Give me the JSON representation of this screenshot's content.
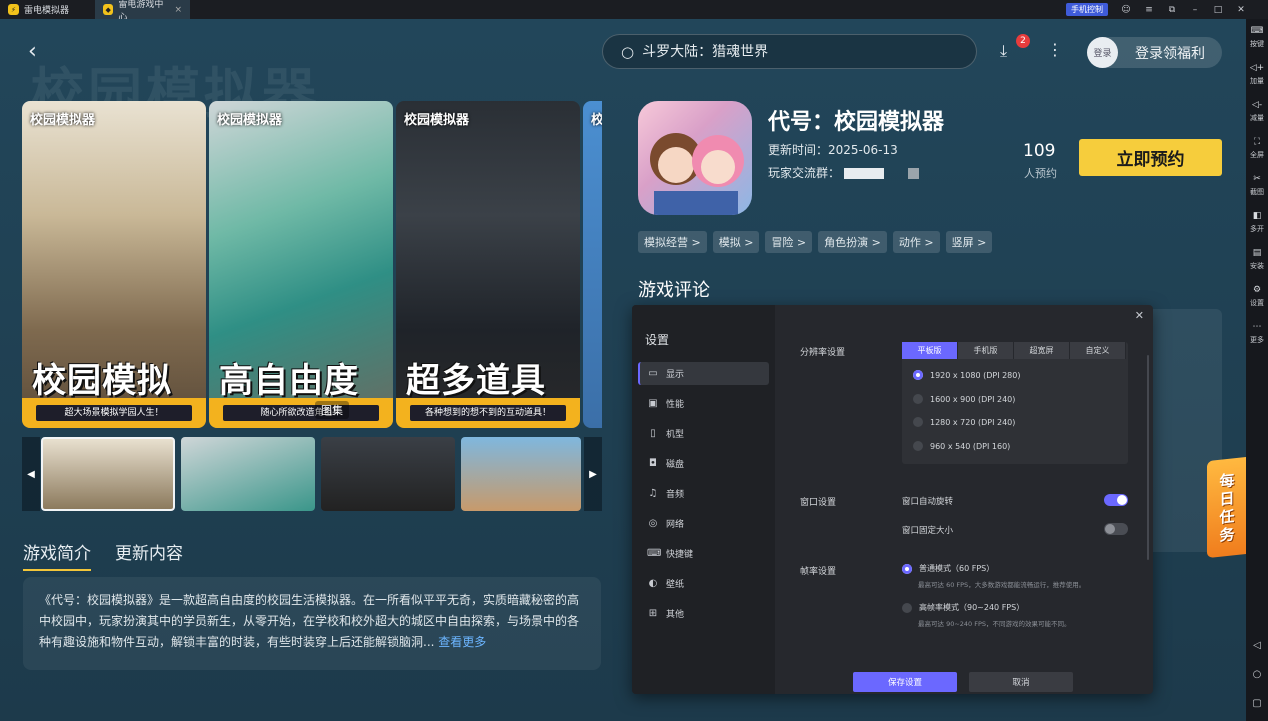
{
  "window_tabs": [
    {
      "label": "雷电模拟器"
    },
    {
      "label": "雷电游戏中心"
    }
  ],
  "titlebar": {
    "phone_control": "手机控制"
  },
  "sidebar": {
    "items": [
      {
        "label": "按键",
        "icon": "keyboard-icon"
      },
      {
        "label": "加量",
        "icon": "volume-up-icon"
      },
      {
        "label": "减量",
        "icon": "volume-down-icon"
      },
      {
        "label": "全屏",
        "icon": "fullscreen-icon"
      },
      {
        "label": "截图",
        "icon": "scissors-icon"
      },
      {
        "label": "多开",
        "icon": "multi-instance-icon"
      },
      {
        "label": "安装",
        "icon": "apk-install-icon"
      },
      {
        "label": "设置",
        "icon": "gear-icon"
      },
      {
        "label": "更多",
        "icon": "more-icon"
      }
    ]
  },
  "header": {
    "search_placeholder": "斗罗大陆：猎魂世界",
    "download_badge": "2",
    "login_avatar": "登录",
    "login_text": "登录领福利"
  },
  "screenshots": [
    {
      "brand": "校园模拟器",
      "headline": "校园模拟",
      "caption": "超大场景模拟学园人生！"
    },
    {
      "brand": "校园模拟器",
      "headline": "高自由度",
      "caption": "随心所欲改造角色！"
    },
    {
      "brand": "校园模拟器",
      "headline": "超多道具",
      "caption": "各种想到的想不到的互动道具！"
    },
    {
      "brand": "校",
      "headline": "",
      "caption": ""
    }
  ],
  "gallery_label": "图集",
  "tabs": [
    {
      "label": "游戏简介"
    },
    {
      "label": "更新内容"
    }
  ],
  "description": {
    "text": "《代号：校园模拟器》是一款超高自由度的校园生活模拟器。在一所看似平平无奇，实质暗藏秘密的高中校园中，玩家扮演其中的学员新生，从零开始，在学校和校外超大的城区中自由探索，与场景中的各种有趣设施和物件互动，解锁丰富的时装，有些时装穿上后还能解锁脑洞...",
    "more_link": "查看更多"
  },
  "game": {
    "name": "代号：校园模拟器",
    "update_time": "更新时间：2025-06-13",
    "group_label": "玩家交流群：",
    "reserve_count": "109",
    "reserve_count_label": "人预约",
    "reserve_button": "立即预约",
    "tags": [
      "模拟经营 >",
      "模拟 >",
      "冒险 >",
      "角色扮演 >",
      "动作 >",
      "竖屏 >"
    ]
  },
  "reviews": {
    "title": "游戏评论"
  },
  "daily_task": [
    "每",
    "日",
    "任",
    "务"
  ],
  "settings": {
    "title": "设置",
    "menu": [
      {
        "label": "显示",
        "icon": "monitor-icon"
      },
      {
        "label": "性能",
        "icon": "performance-icon"
      },
      {
        "label": "机型",
        "icon": "device-icon"
      },
      {
        "label": "磁盘",
        "icon": "disk-icon"
      },
      {
        "label": "音频",
        "icon": "audio-icon"
      },
      {
        "label": "网络",
        "icon": "globe-icon"
      },
      {
        "label": "快捷键",
        "icon": "keyboard-icon"
      },
      {
        "label": "壁纸",
        "icon": "palette-icon"
      },
      {
        "label": "其他",
        "icon": "grid-icon"
      }
    ],
    "resolution": {
      "label": "分辨率设置",
      "tabs": [
        "平板版",
        "手机版",
        "超宽屏",
        "自定义"
      ],
      "options": [
        "1920 x 1080  (DPI 280)",
        "1600 x 900  (DPI 240)",
        "1280 x 720  (DPI 240)",
        "960 x 540  (DPI 160)"
      ],
      "selected_index": 0
    },
    "window": {
      "label": "窗口设置",
      "auto_rotate": "窗口自动旋转",
      "auto_rotate_on": true,
      "fixed_size": "窗口固定大小",
      "fixed_size_on": false
    },
    "fps": {
      "label": "帧率设置",
      "normal": "普通模式（60 FPS）",
      "normal_hint": "最高可达 60 FPS，大多数游戏都能流畅运行，推荐使用。",
      "high": "高帧率模式（90~240 FPS）",
      "high_hint": "最高可达 90~240 FPS，不同游戏的效果可能不同。"
    },
    "save_button": "保存设置",
    "cancel_button": "取消"
  }
}
